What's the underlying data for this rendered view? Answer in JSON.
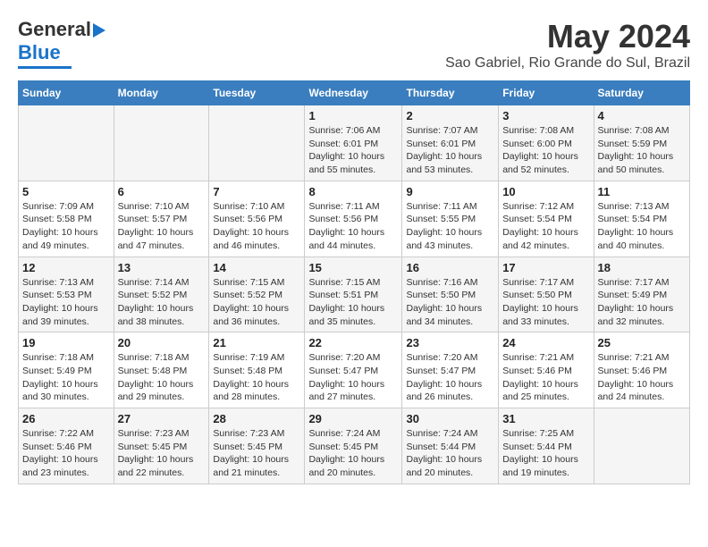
{
  "header": {
    "logo_line1": "General",
    "logo_line2": "Blue",
    "month": "May 2024",
    "location": "Sao Gabriel, Rio Grande do Sul, Brazil"
  },
  "weekdays": [
    "Sunday",
    "Monday",
    "Tuesday",
    "Wednesday",
    "Thursday",
    "Friday",
    "Saturday"
  ],
  "weeks": [
    [
      {
        "day": "",
        "sunrise": "",
        "sunset": "",
        "daylight": ""
      },
      {
        "day": "",
        "sunrise": "",
        "sunset": "",
        "daylight": ""
      },
      {
        "day": "",
        "sunrise": "",
        "sunset": "",
        "daylight": ""
      },
      {
        "day": "1",
        "sunrise": "7:06 AM",
        "sunset": "6:01 PM",
        "daylight": "10 hours and 55 minutes."
      },
      {
        "day": "2",
        "sunrise": "7:07 AM",
        "sunset": "6:01 PM",
        "daylight": "10 hours and 53 minutes."
      },
      {
        "day": "3",
        "sunrise": "7:08 AM",
        "sunset": "6:00 PM",
        "daylight": "10 hours and 52 minutes."
      },
      {
        "day": "4",
        "sunrise": "7:08 AM",
        "sunset": "5:59 PM",
        "daylight": "10 hours and 50 minutes."
      }
    ],
    [
      {
        "day": "5",
        "sunrise": "7:09 AM",
        "sunset": "5:58 PM",
        "daylight": "10 hours and 49 minutes."
      },
      {
        "day": "6",
        "sunrise": "7:10 AM",
        "sunset": "5:57 PM",
        "daylight": "10 hours and 47 minutes."
      },
      {
        "day": "7",
        "sunrise": "7:10 AM",
        "sunset": "5:56 PM",
        "daylight": "10 hours and 46 minutes."
      },
      {
        "day": "8",
        "sunrise": "7:11 AM",
        "sunset": "5:56 PM",
        "daylight": "10 hours and 44 minutes."
      },
      {
        "day": "9",
        "sunrise": "7:11 AM",
        "sunset": "5:55 PM",
        "daylight": "10 hours and 43 minutes."
      },
      {
        "day": "10",
        "sunrise": "7:12 AM",
        "sunset": "5:54 PM",
        "daylight": "10 hours and 42 minutes."
      },
      {
        "day": "11",
        "sunrise": "7:13 AM",
        "sunset": "5:54 PM",
        "daylight": "10 hours and 40 minutes."
      }
    ],
    [
      {
        "day": "12",
        "sunrise": "7:13 AM",
        "sunset": "5:53 PM",
        "daylight": "10 hours and 39 minutes."
      },
      {
        "day": "13",
        "sunrise": "7:14 AM",
        "sunset": "5:52 PM",
        "daylight": "10 hours and 38 minutes."
      },
      {
        "day": "14",
        "sunrise": "7:15 AM",
        "sunset": "5:52 PM",
        "daylight": "10 hours and 36 minutes."
      },
      {
        "day": "15",
        "sunrise": "7:15 AM",
        "sunset": "5:51 PM",
        "daylight": "10 hours and 35 minutes."
      },
      {
        "day": "16",
        "sunrise": "7:16 AM",
        "sunset": "5:50 PM",
        "daylight": "10 hours and 34 minutes."
      },
      {
        "day": "17",
        "sunrise": "7:17 AM",
        "sunset": "5:50 PM",
        "daylight": "10 hours and 33 minutes."
      },
      {
        "day": "18",
        "sunrise": "7:17 AM",
        "sunset": "5:49 PM",
        "daylight": "10 hours and 32 minutes."
      }
    ],
    [
      {
        "day": "19",
        "sunrise": "7:18 AM",
        "sunset": "5:49 PM",
        "daylight": "10 hours and 30 minutes."
      },
      {
        "day": "20",
        "sunrise": "7:18 AM",
        "sunset": "5:48 PM",
        "daylight": "10 hours and 29 minutes."
      },
      {
        "day": "21",
        "sunrise": "7:19 AM",
        "sunset": "5:48 PM",
        "daylight": "10 hours and 28 minutes."
      },
      {
        "day": "22",
        "sunrise": "7:20 AM",
        "sunset": "5:47 PM",
        "daylight": "10 hours and 27 minutes."
      },
      {
        "day": "23",
        "sunrise": "7:20 AM",
        "sunset": "5:47 PM",
        "daylight": "10 hours and 26 minutes."
      },
      {
        "day": "24",
        "sunrise": "7:21 AM",
        "sunset": "5:46 PM",
        "daylight": "10 hours and 25 minutes."
      },
      {
        "day": "25",
        "sunrise": "7:21 AM",
        "sunset": "5:46 PM",
        "daylight": "10 hours and 24 minutes."
      }
    ],
    [
      {
        "day": "26",
        "sunrise": "7:22 AM",
        "sunset": "5:46 PM",
        "daylight": "10 hours and 23 minutes."
      },
      {
        "day": "27",
        "sunrise": "7:23 AM",
        "sunset": "5:45 PM",
        "daylight": "10 hours and 22 minutes."
      },
      {
        "day": "28",
        "sunrise": "7:23 AM",
        "sunset": "5:45 PM",
        "daylight": "10 hours and 21 minutes."
      },
      {
        "day": "29",
        "sunrise": "7:24 AM",
        "sunset": "5:45 PM",
        "daylight": "10 hours and 20 minutes."
      },
      {
        "day": "30",
        "sunrise": "7:24 AM",
        "sunset": "5:44 PM",
        "daylight": "10 hours and 20 minutes."
      },
      {
        "day": "31",
        "sunrise": "7:25 AM",
        "sunset": "5:44 PM",
        "daylight": "10 hours and 19 minutes."
      },
      {
        "day": "",
        "sunrise": "",
        "sunset": "",
        "daylight": ""
      }
    ]
  ]
}
